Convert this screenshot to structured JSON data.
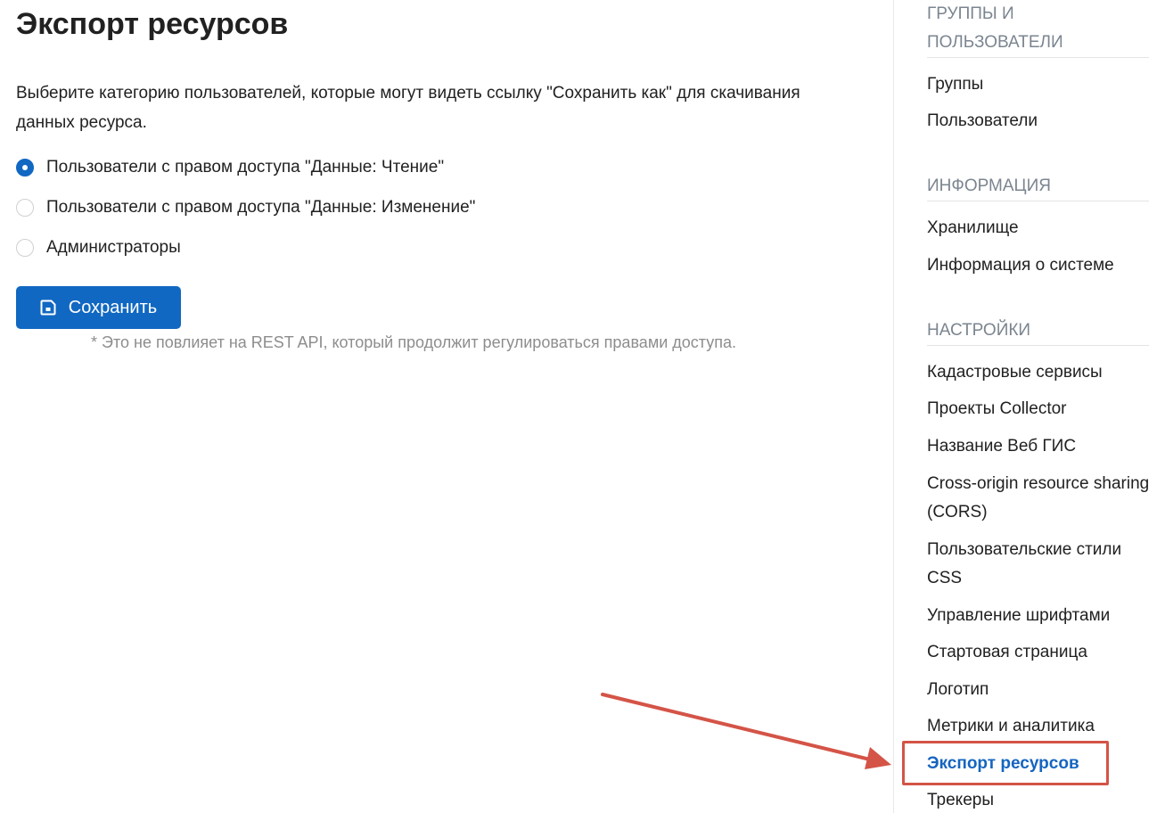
{
  "main": {
    "title": "Экспорт ресурсов",
    "description": "Выберите категорию пользователей, которые могут видеть ссылку \"Сохранить как\" для скачивания данных ресурса.",
    "options": [
      {
        "label": "Пользователи с правом доступа \"Данные: Чтение\"",
        "checked": true
      },
      {
        "label": "Пользователи с правом доступа \"Данные: Изменение\"",
        "checked": false
      },
      {
        "label": "Администраторы",
        "checked": false
      }
    ],
    "save_label": "Сохранить",
    "save_icon": "floppy-disk-icon",
    "note": "* Это не повлияет на REST API, который продолжит регулироваться правами доступа."
  },
  "sidebar": {
    "sections": [
      {
        "title": "ГРУППЫ И ПОЛЬЗОВАТЕЛИ",
        "items": [
          "Группы",
          "Пользователи"
        ]
      },
      {
        "title": "ИНФОРМАЦИЯ",
        "items": [
          "Хранилище",
          "Информация о системе"
        ]
      },
      {
        "title": "НАСТРОЙКИ",
        "items": [
          "Кадастровые сервисы",
          "Проекты Collector",
          "Название Веб ГИС",
          "Cross-origin resource sharing (CORS)",
          "Пользовательские стили CSS",
          "Управление шрифтами",
          "Стартовая страница",
          "Логотип",
          "Метрики и аналитика",
          "Экспорт ресурсов",
          "Трекеры"
        ]
      }
    ],
    "active_item": "Экспорт ресурсов"
  },
  "colors": {
    "accent": "#1168c2",
    "active_link": "#1565c0",
    "section_title": "#7b8590",
    "note": "#8d8d8d",
    "annotation": "#d45447"
  }
}
